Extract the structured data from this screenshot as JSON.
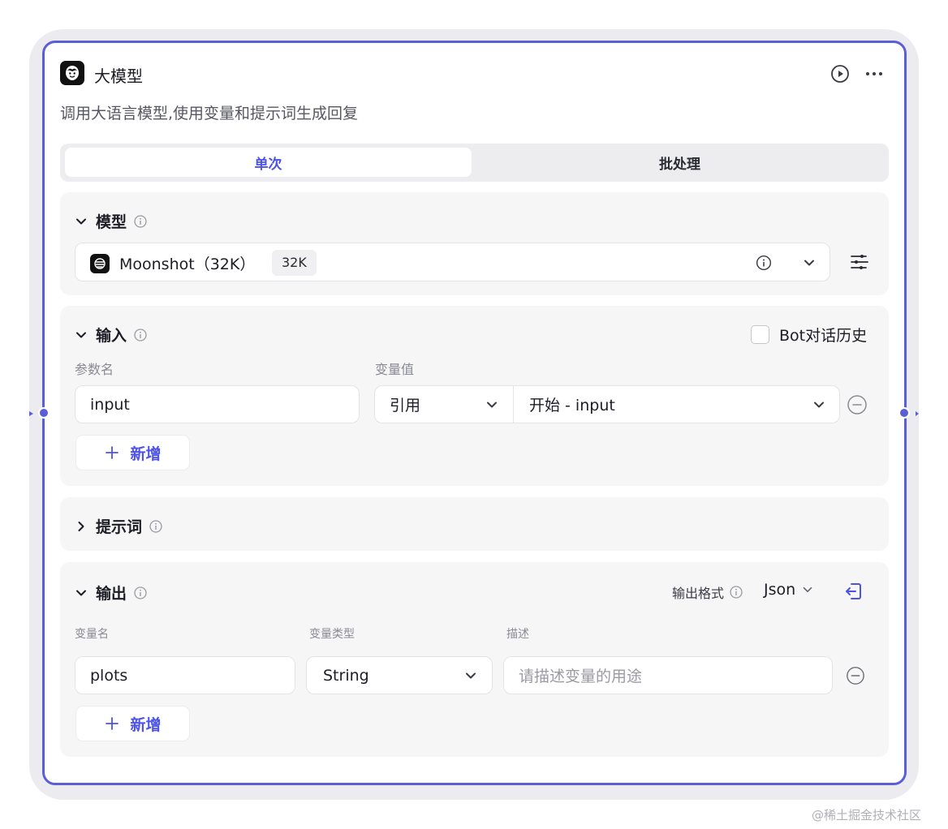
{
  "node": {
    "title": "大模型",
    "description": "调用大语言模型,使用变量和提示词生成回复"
  },
  "tabs": [
    {
      "label": "单次",
      "active": true
    },
    {
      "label": "批处理",
      "active": false
    }
  ],
  "model_section": {
    "title": "模型",
    "model_name": "Moonshot（32K）",
    "context_badge": "32K"
  },
  "input_section": {
    "title": "输入",
    "bot_history_label": "Bot对话历史",
    "bot_history_checked": false,
    "col_param_name": "参数名",
    "col_var_value": "变量值",
    "rows": [
      {
        "name": "input",
        "mode": "引用",
        "value": "开始 - input"
      }
    ],
    "add_label": "新增"
  },
  "prompt_section": {
    "title": "提示词"
  },
  "output_section": {
    "title": "输出",
    "format_label": "输出格式",
    "format_value": "Json",
    "col_var_name": "变量名",
    "col_var_type": "变量类型",
    "col_desc": "描述",
    "rows": [
      {
        "name": "plots",
        "type": "String",
        "desc_placeholder": "请描述变量的用途"
      }
    ],
    "add_label": "新增"
  },
  "watermark": "@稀土掘金技术社区",
  "colors": {
    "accent": "#4d53e8",
    "border_active": "#5a5fd6",
    "section_bg": "#f6f6f7"
  },
  "icons": {
    "node": "llm-face-icon",
    "run": "play-icon",
    "more": "more-icon",
    "model": "moonshot-logo-icon",
    "settings": "sliders-icon",
    "output_switch": "import-icon"
  }
}
